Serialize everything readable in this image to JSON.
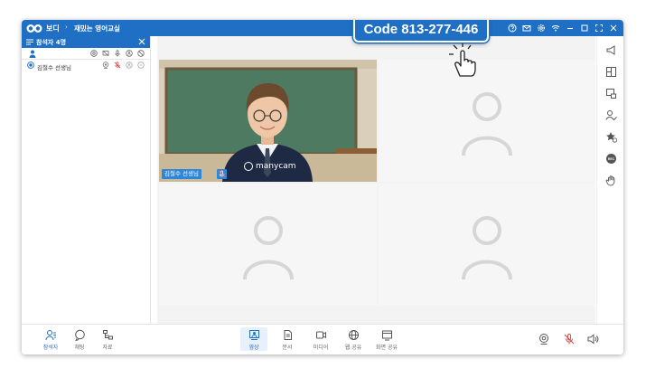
{
  "app": {
    "brand": "보디",
    "title_separator": "›",
    "room_title": "재밌는 영어교실"
  },
  "callout": {
    "text": "Code 813-277-446",
    "cursor": "pointing-hand-cursor"
  },
  "titlebar_icons": [
    "help-icon",
    "mail-icon",
    "settings-icon",
    "wifi-icon",
    "minimize-icon",
    "maximize-icon",
    "fullscreen-icon",
    "close-icon"
  ],
  "sidebar": {
    "title": "참석자 4명",
    "column_icons": [
      "camera-icon",
      "screen-share-icon",
      "mic-icon",
      "control-icon",
      "chat-block-icon"
    ],
    "participants": [
      {
        "name": "김철수 선생님",
        "status_icons": [
          "camera-icon",
          "mic-muted-icon",
          "control-icon",
          "chat-icon"
        ]
      }
    ]
  },
  "video": {
    "tiles": [
      {
        "label": "김철수 선생님",
        "watermark": "manycam",
        "has_video": true
      },
      {
        "label": "",
        "has_video": false
      },
      {
        "label": "",
        "has_video": false
      },
      {
        "label": "",
        "has_video": false
      }
    ]
  },
  "rightbar_icons": [
    "announce-icon",
    "layout-icon",
    "screen-record-icon",
    "user-check-icon",
    "star-add-icon",
    "rec-icon",
    "raise-hand-icon"
  ],
  "rightbar_rec_label": "REC",
  "bottombar": {
    "left": [
      {
        "label": "참석자",
        "icon": "participants-icon",
        "active": true
      },
      {
        "label": "채팅",
        "icon": "chat-icon",
        "active": false
      },
      {
        "label": "자료",
        "icon": "files-icon",
        "active": false
      }
    ],
    "center": [
      {
        "label": "영상",
        "icon": "video-layout-icon",
        "active": true
      },
      {
        "label": "문서",
        "icon": "document-icon",
        "active": false
      },
      {
        "label": "미디어",
        "icon": "media-icon",
        "active": false
      },
      {
        "label": "웹 공유",
        "icon": "web-share-icon",
        "active": false
      },
      {
        "label": "화면 공유",
        "icon": "screen-share-icon",
        "active": false
      }
    ],
    "right_icons": [
      "webcam-icon",
      "mic-muted-icon",
      "speaker-icon"
    ]
  },
  "colors": {
    "accent": "#1f6fc4",
    "muted_red": "#d9534f",
    "placeholder": "#d4d4d4"
  }
}
